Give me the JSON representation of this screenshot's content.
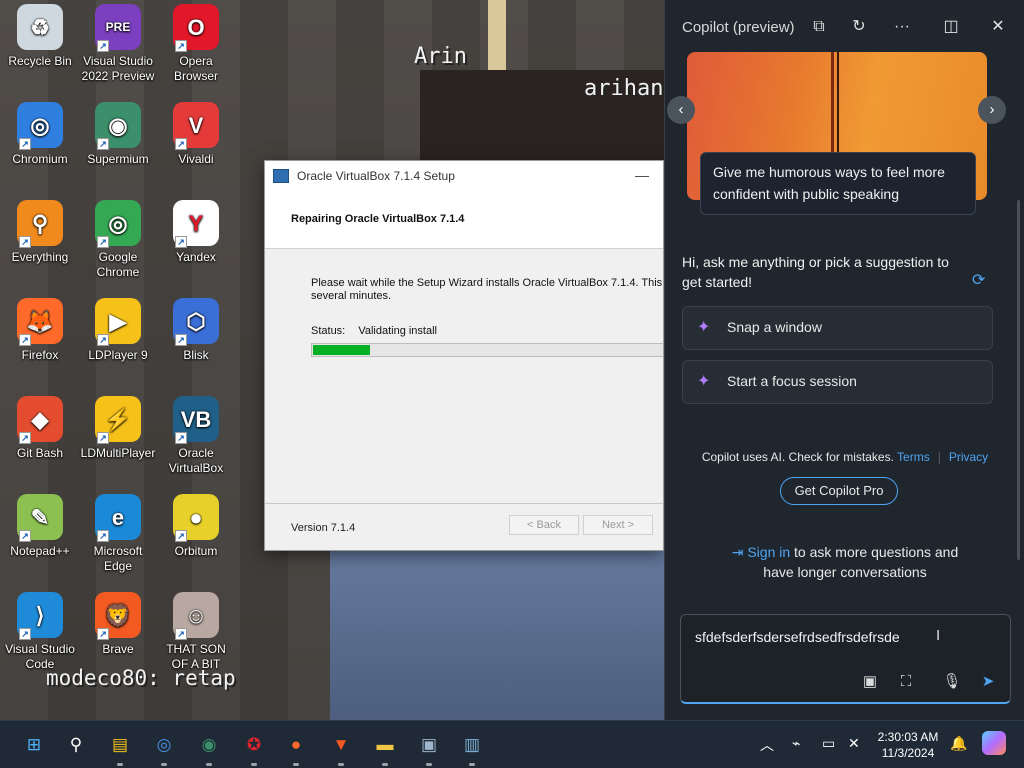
{
  "desktop": {
    "icons": [
      {
        "label": "Recycle Bin",
        "glyph": "♻",
        "color": "#cfd8df",
        "icon": "recycle-bin-icon"
      },
      {
        "label": "Visual Studio\n2022 Preview",
        "glyph": "PRE",
        "color": "#7b3fbf",
        "icon": "visual-studio-preview-icon"
      },
      {
        "label": "Opera\nBrowser",
        "glyph": "O",
        "color": "#e3172a",
        "icon": "opera-icon"
      },
      {
        "label": "Chromium",
        "glyph": "◎",
        "color": "#2f7fe0",
        "icon": "chromium-icon"
      },
      {
        "label": "Supermium",
        "glyph": "◉",
        "color": "#3b8f6b",
        "icon": "supermium-icon"
      },
      {
        "label": "Vivaldi",
        "glyph": "V",
        "color": "#e53a3a",
        "icon": "vivaldi-icon"
      },
      {
        "label": "Everything",
        "glyph": "⚲",
        "color": "#f08a1c",
        "icon": "everything-search-icon"
      },
      {
        "label": "Google\nChrome",
        "glyph": "◎",
        "color": "#34a853",
        "icon": "google-chrome-icon"
      },
      {
        "label": "Yandex",
        "glyph": "Y",
        "color": "#ffffff",
        "icon": "yandex-icon"
      },
      {
        "label": "Firefox",
        "glyph": "🦊",
        "color": "#ff6a2b",
        "icon": "firefox-icon"
      },
      {
        "label": "LDPlayer 9",
        "glyph": "▶",
        "color": "#f6c21a",
        "icon": "ldplayer-icon"
      },
      {
        "label": "Blisk",
        "glyph": "⬡",
        "color": "#3a6fd8",
        "icon": "blisk-icon"
      },
      {
        "label": "Git Bash",
        "glyph": "◆",
        "color": "#e44c30",
        "icon": "git-bash-icon"
      },
      {
        "label": "LDMultiPlayer",
        "glyph": "⚡",
        "color": "#f6c21a",
        "icon": "ldmultiplayer-icon"
      },
      {
        "label": "Oracle\nVirtualBox",
        "glyph": "VB",
        "color": "#1f5f88",
        "icon": "virtualbox-icon"
      },
      {
        "label": "Notepad++",
        "glyph": "✎",
        "color": "#8cc152",
        "icon": "notepad-plus-plus-icon"
      },
      {
        "label": "Microsoft\nEdge",
        "glyph": "e",
        "color": "#1a8ad8",
        "icon": "microsoft-edge-icon"
      },
      {
        "label": "Orbitum",
        "glyph": "●",
        "color": "#e8d02a",
        "icon": "orbitum-icon"
      },
      {
        "label": "Visual Studio\nCode",
        "glyph": "⟩",
        "color": "#1f8ad8",
        "icon": "vscode-icon"
      },
      {
        "label": "Brave",
        "glyph": "🦁",
        "color": "#f25a22",
        "icon": "brave-icon"
      },
      {
        "label": "THAT SON\nOF A BIT",
        "glyph": "☺",
        "color": "#b9a8a2",
        "icon": "image-file-icon"
      }
    ],
    "wallpaper_text": [
      "Arin",
      "arihanta",
      "modeco80: retap"
    ]
  },
  "installer": {
    "title": "Oracle VirtualBox 7.1.4 Setup",
    "minimize": "—",
    "heading": "Repairing Oracle VirtualBox 7.1.4",
    "description": "Please wait while the Setup Wizard installs Oracle VirtualBox 7.1.4. This m several minutes.",
    "status_label": "Status:",
    "status_value": "Validating install",
    "progress": 0.16,
    "version": "Version 7.1.4",
    "back_label": "< Back",
    "next_label": "Next >"
  },
  "copilot": {
    "title": "Copilot (preview)",
    "suggestion_tip": "Give me humorous ways to feel more confident with public speaking",
    "greeting": "Hi, ask me anything or pick a suggestion to get started!",
    "chips": [
      "Snap a window",
      "Start a focus session"
    ],
    "disclaimer": "Copilot uses AI. Check for mistakes.",
    "terms": "Terms",
    "privacy": "Privacy",
    "pro_button": "Get Copilot Pro",
    "signin_link": "Sign in",
    "signin_rest": "to ask more questions and have longer conversations",
    "composer_text": "sfdefsderfsdersefrdsedfrsdefrsde",
    "accent": "#4ea5f3"
  },
  "taskbar": {
    "items": [
      {
        "glyph": "⊞",
        "icon": "windows-start-icon",
        "color": "#4fb3ff"
      },
      {
        "glyph": "⚲",
        "icon": "search-icon",
        "color": "#ffffff"
      },
      {
        "glyph": "▤",
        "icon": "ldplayer-taskbar-icon",
        "color": "#f6c21a"
      },
      {
        "glyph": "◎",
        "icon": "chromium-taskbar-icon",
        "color": "#4a90e2"
      },
      {
        "glyph": "◉",
        "icon": "supermium-taskbar-icon",
        "color": "#3b8f6b"
      },
      {
        "glyph": "✪",
        "icon": "app-taskbar-icon",
        "color": "#e0242a"
      },
      {
        "glyph": "●",
        "icon": "firefox-taskbar-icon",
        "color": "#ff6a2b"
      },
      {
        "glyph": "▼",
        "icon": "brave-taskbar-icon",
        "color": "#f25a22"
      },
      {
        "glyph": "▬",
        "icon": "file-explorer-icon",
        "color": "#f4c542"
      },
      {
        "glyph": "▣",
        "icon": "installer-taskbar-icon",
        "color": "#9fb7cc"
      },
      {
        "glyph": "▥",
        "icon": "virtualbox-taskbar-icon",
        "color": "#7fb3d9"
      }
    ],
    "time": "2:30:03 AM",
    "date": "11/3/2024"
  }
}
